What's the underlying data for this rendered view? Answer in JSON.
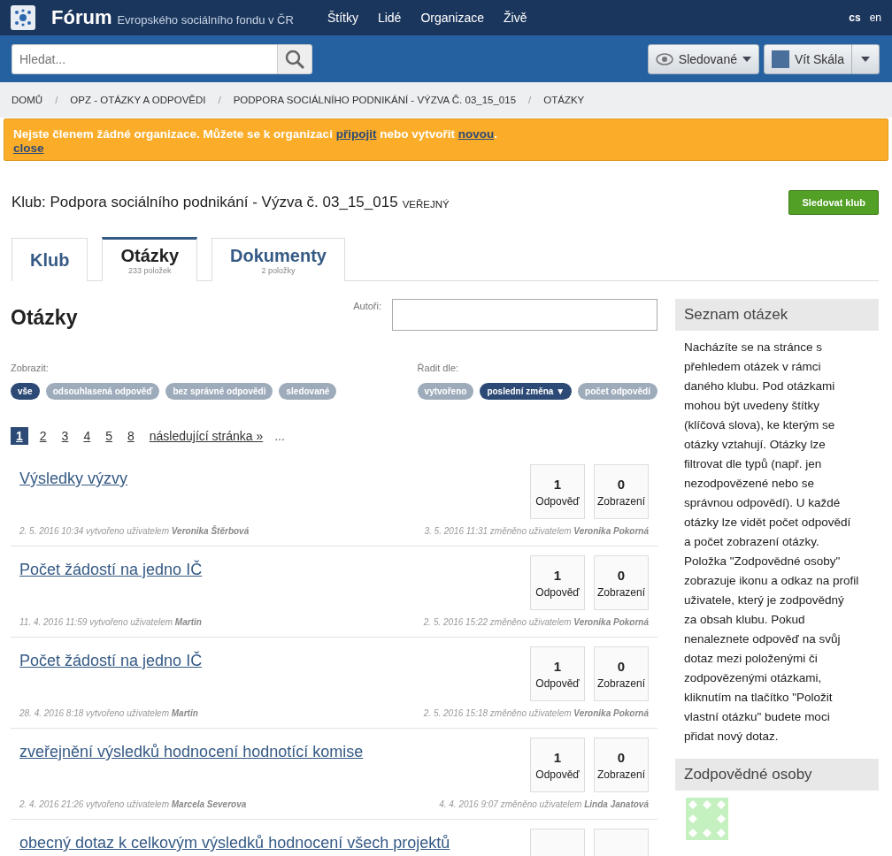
{
  "header": {
    "logo_title": "Fórum",
    "subtitle": "Evropského sociálního fondu v ČR",
    "nav": [
      "Štítky",
      "Lidé",
      "Organizace",
      "Živě"
    ],
    "languages": [
      {
        "label": "cs",
        "selected": true
      },
      {
        "label": "en",
        "selected": false
      }
    ]
  },
  "search": {
    "placeholder": "Hledat..."
  },
  "watch_button": "Sledované",
  "user_button": "Vít Skála",
  "breadcrumb_separator": "/",
  "breadcrumb": [
    "DOMŮ",
    "OPZ - OTÁZKY A ODPOVĚDI",
    "PODPORA SOCIÁLNÍHO PODNIKÁNÍ - VÝZVA Č. 03_15_015",
    "OTÁZKY"
  ],
  "alert": {
    "text_1": "Nejste členem žádné organizace. Můžete se k organizaci ",
    "link_1": "připojit",
    "text_2": " nebo vytvořit ",
    "link_2": "novou",
    "text_3": ".",
    "close": "close"
  },
  "club": {
    "title": "Klub: Podpora sociálního podnikání - Výzva č. 03_15_015",
    "badge": "VEŘEJNÝ",
    "follow_button": "Sledovat klub"
  },
  "tabs": [
    {
      "label": "Klub",
      "selected": false
    },
    {
      "label": "Otázky",
      "count": "233 položek",
      "selected": true
    },
    {
      "label": "Dokumenty",
      "count": "2 položky",
      "selected": false
    }
  ],
  "questions_heading": "Otázky",
  "authors_label": "Autoři:",
  "show": {
    "label": "Zobrazit:",
    "options": [
      {
        "label": "vše",
        "selected": true
      },
      {
        "label": "odsouhlasená odpověď",
        "selected": false
      },
      {
        "label": "bez správné odpovědi",
        "selected": false
      },
      {
        "label": "sledované",
        "selected": false
      }
    ]
  },
  "sort": {
    "label": "Řadit dle:",
    "options": [
      {
        "label": "vytvořeno",
        "selected": false
      },
      {
        "label": "poslední změna ▼",
        "selected": true
      },
      {
        "label": "počet odpovědí",
        "selected": false
      }
    ]
  },
  "pagination": {
    "pages": [
      {
        "label": "1",
        "selected": true
      },
      {
        "label": "2",
        "selected": false
      },
      {
        "label": "3",
        "selected": false
      },
      {
        "label": "4",
        "selected": false
      },
      {
        "label": "5",
        "selected": false
      },
      {
        "label": "8",
        "selected": false
      }
    ],
    "next": "následující stránka »",
    "ellipsis": "..."
  },
  "questions": [
    {
      "title": "Výsledky výzvy",
      "answers": "1",
      "answers_label": "Odpověď",
      "views": "0",
      "views_label": "Zobrazení",
      "created": "2. 5. 2016 10:34 vytvořeno uživatelem **Veronika Štěrbová**",
      "modified": "3. 5. 2016 11:31 změněno uživatelem **Veronika Pokorná**"
    },
    {
      "title": "Počet žádostí na jedno IČ",
      "answers": "1",
      "answers_label": "Odpověď",
      "views": "0",
      "views_label": "Zobrazení",
      "created": "11. 4. 2016 11:59 vytvořeno uživatelem **Martin**",
      "modified": "2. 5. 2016 15:22 změněno uživatelem **Veronika Pokorná**"
    },
    {
      "title": "Počet žádostí na jedno IČ",
      "answers": "1",
      "answers_label": "Odpověď",
      "views": "0",
      "views_label": "Zobrazení",
      "created": "28. 4. 2016 8:18 vytvořeno uživatelem **Martin**",
      "modified": "2. 5. 2016 15:18 změněno uživatelem **Veronika Pokorná**"
    },
    {
      "title": "zveřejnění výsledků hodnocení hodnotící komise",
      "answers": "1",
      "answers_label": "Odpověď",
      "views": "0",
      "views_label": "Zobrazení",
      "created": "2. 4. 2016 21:26 vytvořeno uživatelem **Marcela Severova**",
      "modified": "4. 4. 2016 9:07 změněno uživatelem **Linda Janatová**"
    },
    {
      "title": "obecný dotaz k celkovým výsledků hodnocení všech projektů"
    }
  ],
  "sidebar": {
    "list_heading": "Seznam otázek",
    "description": "Nacházíte se na stránce s přehledem otázek v rámci daného klubu. Pod otázkami mohou být uvedeny štítky (klíčová slova), ke kterým se otázky vztahují. Otázky lze filtrovat dle typů (např. jen nezodpovězené nebo se správnou odpovědí). U každé otázky lze vidět počet odpovědí a počet zobrazení otázky. Položka \"Zodpovědné osoby\" zobrazuje ikonu a odkaz na profil uživatele, který je zodpovědný za obsah klubu. Pokud nenaleznete odpověď na svůj dotaz mezi položenými či zodpovězenými otázkami, kliknutím na tlačítko \"Položit vlastní otázku\" budete moci přidat nový dotaz.",
    "persons_heading": "Zodpovědné osoby"
  }
}
